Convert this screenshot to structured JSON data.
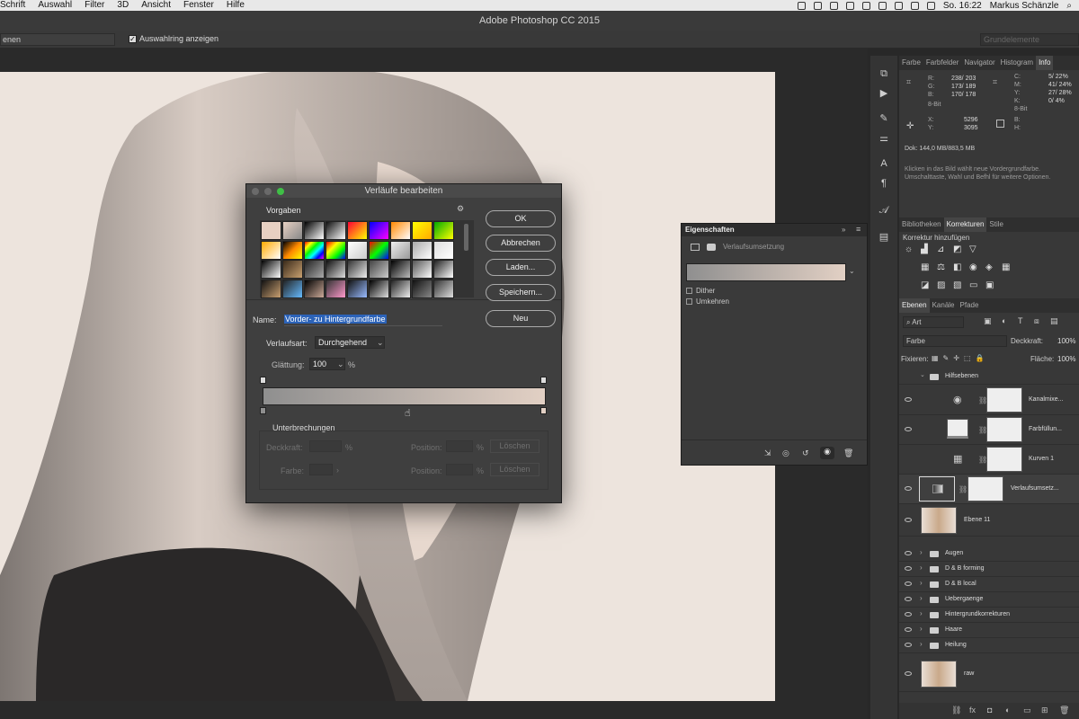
{
  "menubar": {
    "items": [
      "Schrift",
      "Auswahl",
      "Filter",
      "3D",
      "Ansicht",
      "Fenster",
      "Hilfe"
    ],
    "clock": "So. 16:22",
    "user": "Markus Schänzle"
  },
  "window": {
    "title": "Adobe Photoshop CC 2015"
  },
  "options": {
    "tool_select": "enen",
    "checkbox_label": "Auswahlring anzeigen",
    "workspace": "Grundelemente"
  },
  "info_panel": {
    "tabs": [
      "Farbe",
      "Farbfelder",
      "Navigator",
      "Histogram",
      "Info"
    ],
    "active_tab": "Info",
    "rgb_labels": [
      "R:",
      "G:",
      "B:"
    ],
    "rgb_values": [
      "238/ 203",
      "173/ 189",
      "170/ 178"
    ],
    "cmyk_labels": [
      "C:",
      "M:",
      "Y:",
      "K:"
    ],
    "cmyk_values": [
      "5/ 22%",
      "41/ 24%",
      "27/ 28%",
      "0/ 4%"
    ],
    "bit_left": "8-Bit",
    "bit_right": "8-Bit",
    "x_label": "X:",
    "x_value": "5296",
    "y_label": "Y:",
    "y_value": "3095",
    "b_label": "B:",
    "h_label": "H:",
    "doc": "Dok: 144,0 MB/883,5 MB",
    "hint": "Klicken in das Bild wählt neue Vordergrundfarbe. Umschalttaste, Wahl und Befhl für weitere Optionen."
  },
  "adjustments_panel": {
    "tabs": [
      "Bibliotheken",
      "Korrekturen",
      "Stile"
    ],
    "active_tab": "Korrekturen",
    "heading": "Korrektur hinzufügen"
  },
  "layers_panel": {
    "tabs": [
      "Ebenen",
      "Kanäle",
      "Pfade"
    ],
    "active_tab": "Ebenen",
    "filter": "Art",
    "blend_mode": "Farbe",
    "opacity_label": "Deckkraft:",
    "opacity": "100%",
    "lock_label": "Fixieren:",
    "fill_label": "Fläche:",
    "fill": "100%",
    "group_top": "Hilfsebenen",
    "adj_layers": [
      "Kanalmixe...",
      "Farbfüllun...",
      "Kurven 1",
      "Verlaufsumsetz..."
    ],
    "image_layer": "Ebene 11",
    "groups": [
      "Augen",
      "D & B forming",
      "D & B local",
      "Uebergaenge",
      "Hintergrundkorrekturen",
      "Haare",
      "Heilung"
    ],
    "raw_layer": "raw"
  },
  "properties_panel": {
    "title": "Eigenschaften",
    "type_label": "Verlaufsumsetzung",
    "dither": "Dither",
    "reverse": "Umkehren"
  },
  "gradient_editor": {
    "title": "Verläufe bearbeiten",
    "presets_label": "Vorgaben",
    "buttons": {
      "ok": "OK",
      "cancel": "Abbrechen",
      "load": "Laden...",
      "save": "Speichern...",
      "new": "Neu"
    },
    "name_label": "Name:",
    "name_value": "Vorder- zu Hintergrundfarbe",
    "type_label": "Verlaufsart:",
    "type_value": "Durchgehend",
    "smooth_label": "Glättung:",
    "smooth_value": "100",
    "smooth_unit": "%",
    "stops_label": "Unterbrechungen",
    "opacity_label": "Deckkraft:",
    "color_label": "Farbe:",
    "position_label": "Position:",
    "percent": "%",
    "delete": "Löschen"
  },
  "colors": {
    "gradient_start": "#8f8f8f",
    "gradient_end": "#e2d0c4",
    "canvas": "#ede4dd",
    "selection": "#2c63b8"
  }
}
